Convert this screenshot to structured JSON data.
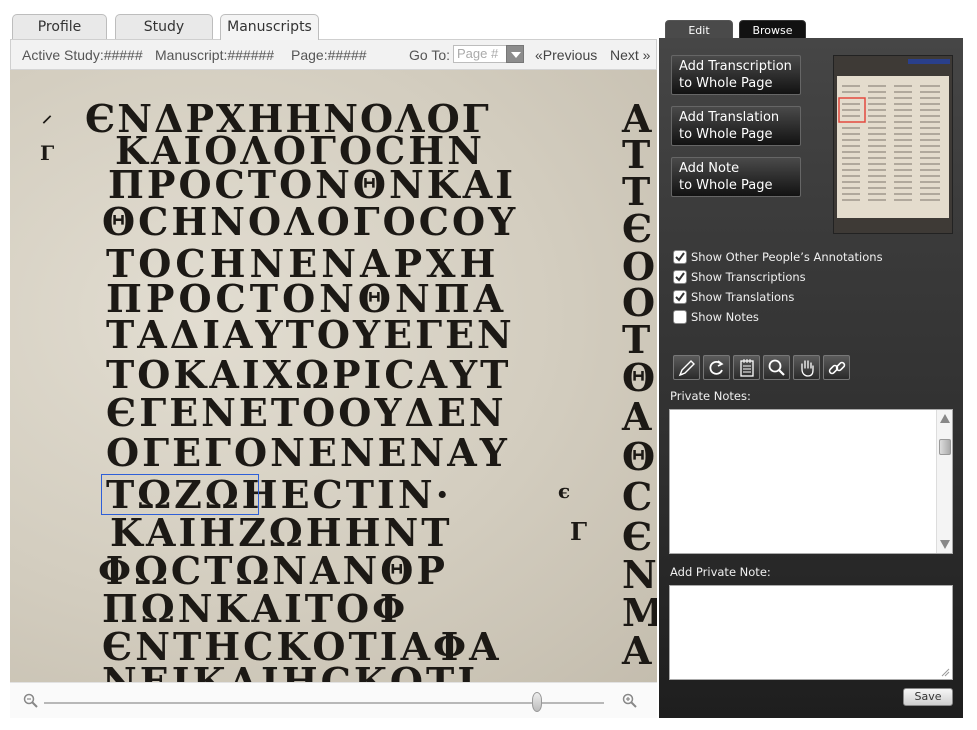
{
  "tabs": [
    "Profile",
    "Study",
    "Manuscripts"
  ],
  "infobar": {
    "active_study": "Active Study:#####",
    "manuscript": "Manuscript:######",
    "page": "Page:#####",
    "goto_label": "Go To:",
    "goto_placeholder": "Page #",
    "previous": "«Previous",
    "next": "Next »"
  },
  "zoom": {
    "level": 0.88
  },
  "panel": {
    "tabs": [
      "Edit",
      "Browse"
    ],
    "add_transcription": [
      "Add Transcription",
      "to Whole Page"
    ],
    "add_translation": [
      "Add Translation",
      "to Whole Page"
    ],
    "add_note": [
      "Add Note",
      "to Whole Page"
    ],
    "checkboxes": [
      {
        "label": "Show Other People’s Annotations",
        "checked": true
      },
      {
        "label": "Show Transcriptions",
        "checked": true
      },
      {
        "label": "Show Translations",
        "checked": true
      },
      {
        "label": "Show Notes",
        "checked": false
      }
    ],
    "tools": [
      "pencil-icon",
      "refresh-icon",
      "notepad-icon",
      "magnifier-icon",
      "hand-icon",
      "link-icon"
    ],
    "private_notes_label": "Private Notes:",
    "add_private_note_label": "Add Private Note:",
    "save": "Save"
  },
  "colors": {
    "panel_bg": "#3a3a3a",
    "selection": "#2e5fd8",
    "thumbnail_highlight": "#e34a3f"
  }
}
